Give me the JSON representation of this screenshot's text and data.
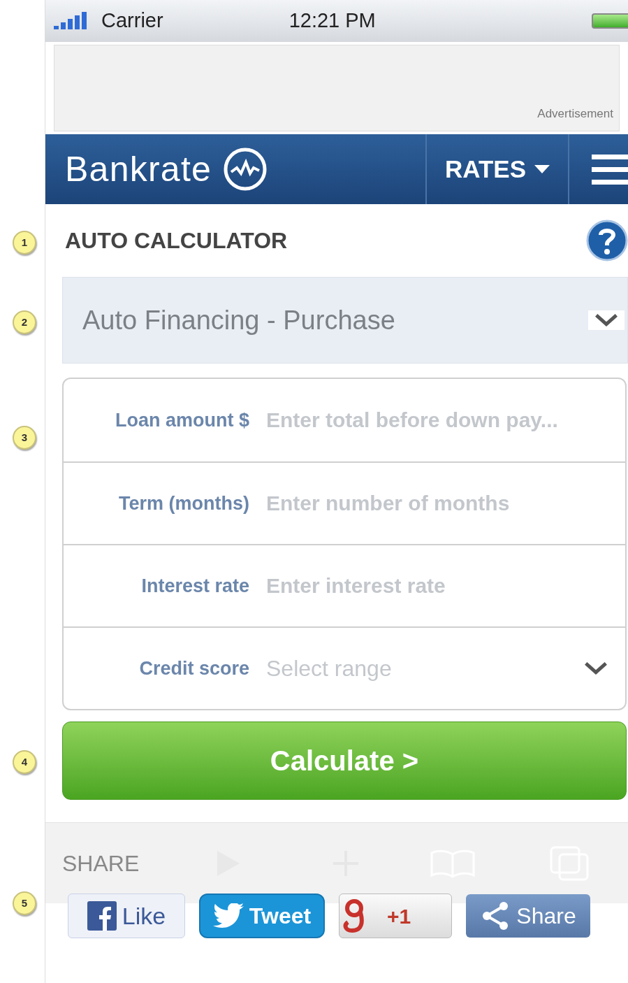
{
  "status_bar": {
    "carrier": "Carrier",
    "time": "12:21 PM"
  },
  "ad": {
    "label": "Advertisement"
  },
  "nav": {
    "logo": "Bankrate",
    "rates": "RATES"
  },
  "callouts": [
    "1",
    "2",
    "3",
    "4",
    "5"
  ],
  "title": "AUTO CALCULATOR",
  "calculator_type": {
    "value": "Auto Financing - Purchase"
  },
  "fields": [
    {
      "kind": "input",
      "label": "Loan amount $",
      "placeholder": "Enter total before down pay..."
    },
    {
      "kind": "input",
      "label": "Term (months)",
      "placeholder": "Enter number of months"
    },
    {
      "kind": "input",
      "label": "Interest rate",
      "placeholder": "Enter interest rate"
    },
    {
      "kind": "select",
      "label": "Credit score",
      "placeholder": "Select range"
    }
  ],
  "calculate_button": "Calculate >",
  "share": {
    "heading": "SHARE",
    "buttons": [
      {
        "kind": "facebook",
        "label": "Like"
      },
      {
        "kind": "twitter",
        "label": "Tweet"
      },
      {
        "kind": "google",
        "label": "+1"
      },
      {
        "kind": "share",
        "label": "Share"
      }
    ]
  }
}
